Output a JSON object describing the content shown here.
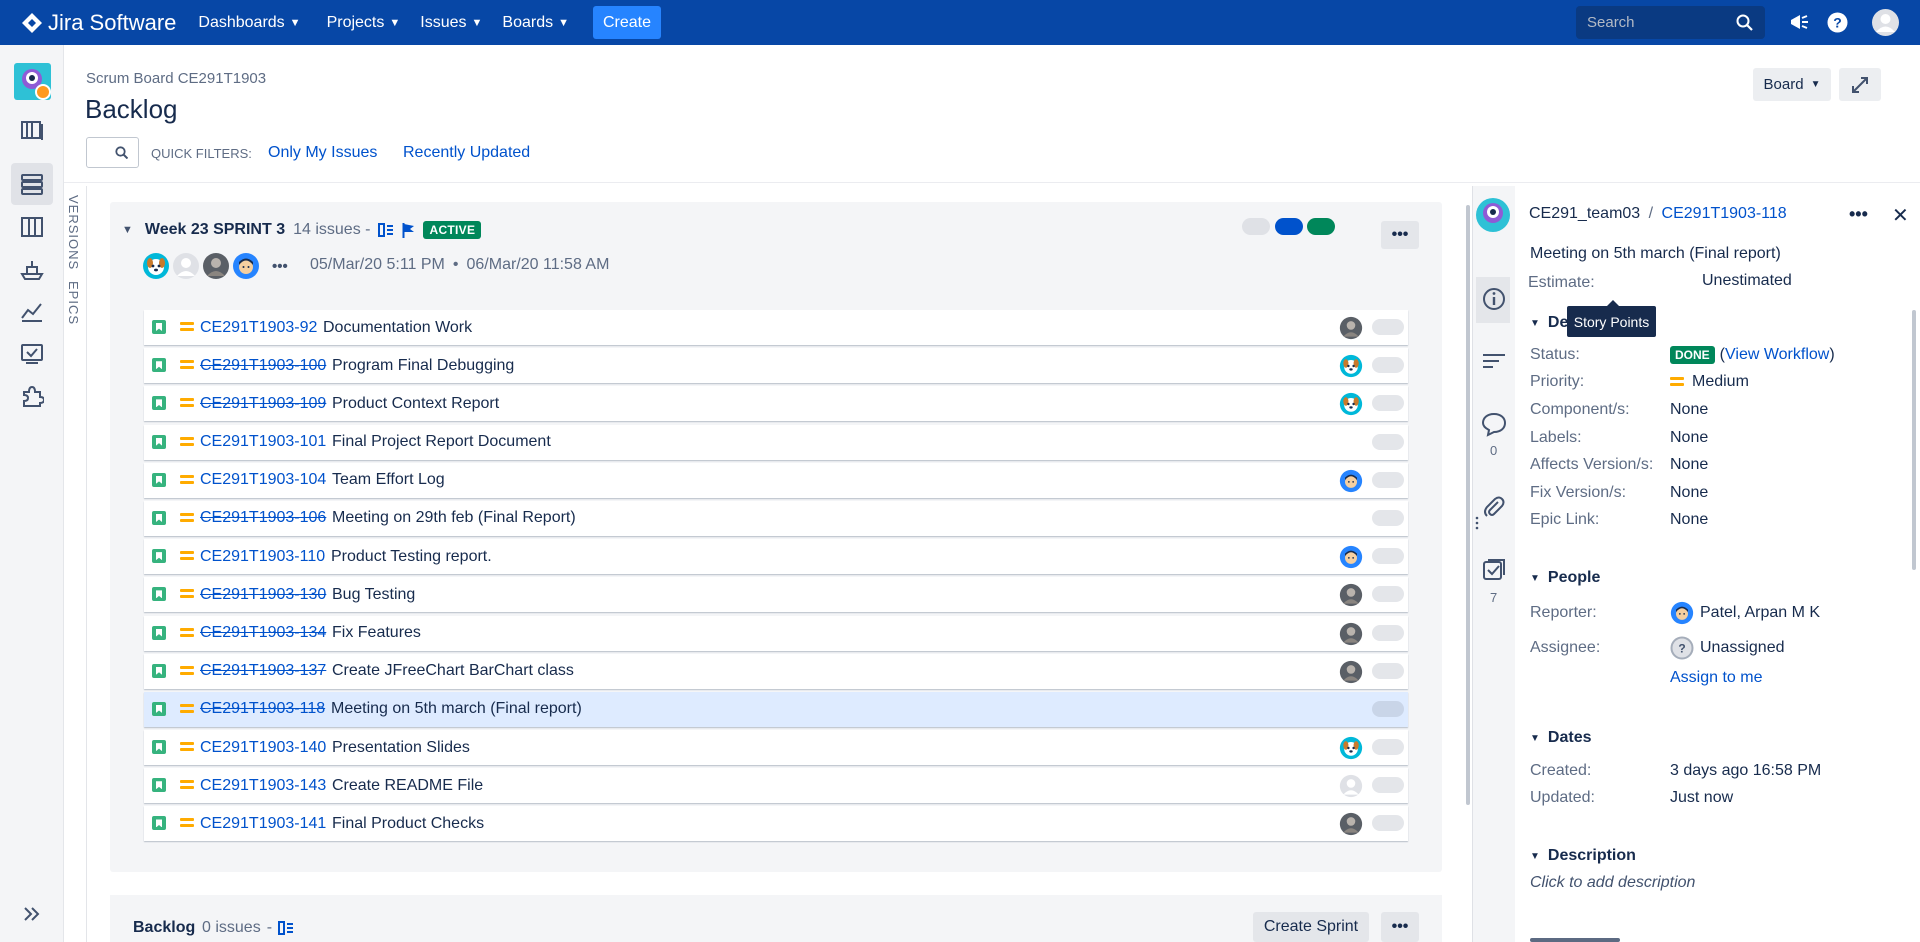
{
  "nav": {
    "logo": "Jira Software",
    "menus": [
      "Dashboards",
      "Projects",
      "Issues",
      "Boards"
    ],
    "create": "Create",
    "search_placeholder": "Search"
  },
  "header": {
    "breadcrumb": "Scrum Board CE291T1903",
    "title": "Backlog",
    "board_button": "Board"
  },
  "quick_filters": {
    "label": "QUICK FILTERS:",
    "items": [
      "Only My Issues",
      "Recently Updated"
    ]
  },
  "side_tabs": {
    "versions": "VERSIONS",
    "epics": "EPICS"
  },
  "sprint": {
    "title": "Week 23 SPRINT 3",
    "count": "14 issues",
    "count_sep": "-",
    "status": "ACTIVE",
    "start": "05/Mar/20 5:11 PM",
    "date_sep": "•",
    "end": "06/Mar/20 11:58 AM",
    "more": "•••",
    "avatars_more": "•••",
    "status_colors": [
      "#dfe1e6",
      "#0052cc",
      "#00875a"
    ]
  },
  "issues": [
    {
      "key": "CE291T1903-92",
      "summary": "Documentation Work",
      "done": false,
      "avatar": "photo"
    },
    {
      "key": "CE291T1903-100",
      "summary": "Program Final Debugging",
      "done": true,
      "avatar": "dog"
    },
    {
      "key": "CE291T1903-109",
      "summary": "Product Context Report",
      "done": true,
      "avatar": "dog"
    },
    {
      "key": "CE291T1903-101",
      "summary": "Final Project Report Document",
      "done": false,
      "avatar": "none"
    },
    {
      "key": "CE291T1903-104",
      "summary": "Team Effort Log",
      "done": false,
      "avatar": "man"
    },
    {
      "key": "CE291T1903-106",
      "summary": "Meeting on 29th feb (Final Report)",
      "done": true,
      "avatar": "none"
    },
    {
      "key": "CE291T1903-110",
      "summary": "Product Testing report.",
      "done": false,
      "avatar": "man"
    },
    {
      "key": "CE291T1903-130",
      "summary": "Bug Testing",
      "done": true,
      "avatar": "photo"
    },
    {
      "key": "CE291T1903-134",
      "summary": "Fix Features",
      "done": true,
      "avatar": "photo"
    },
    {
      "key": "CE291T1903-137",
      "summary": "Create JFreeChart BarChart class",
      "done": true,
      "avatar": "photo"
    },
    {
      "key": "CE291T1903-118",
      "summary": "Meeting on 5th march (Final report)",
      "done": true,
      "avatar": "none",
      "selected": true
    },
    {
      "key": "CE291T1903-140",
      "summary": "Presentation Slides",
      "done": false,
      "avatar": "dog"
    },
    {
      "key": "CE291T1903-143",
      "summary": "Create README File",
      "done": false,
      "avatar": "default"
    },
    {
      "key": "CE291T1903-141",
      "summary": "Final Product Checks",
      "done": false,
      "avatar": "photo"
    }
  ],
  "backlog": {
    "title": "Backlog",
    "count": "0 issues",
    "count_sep": "-",
    "create_sprint": "Create Sprint",
    "more": "•••"
  },
  "detail": {
    "project": "CE291_team03",
    "separator": "/",
    "key": "CE291T1903-118",
    "more": "•••",
    "close": "✕",
    "summary": "Meeting on 5th march (Final report)",
    "estimate_label": "Estimate:",
    "estimate_value": "Unestimated",
    "tooltip": "Story Points",
    "details_title": "De",
    "status_label": "Status:",
    "status_value": "DONE",
    "view_workflow": "View Workflow",
    "priority_label": "Priority:",
    "priority_value": "Medium",
    "fields": [
      {
        "label": "Component/s:",
        "value": "None"
      },
      {
        "label": "Labels:",
        "value": "None"
      },
      {
        "label": "Affects Version/s:",
        "value": "None"
      },
      {
        "label": "Fix Version/s:",
        "value": "None"
      },
      {
        "label": "Epic Link:",
        "value": "None"
      }
    ],
    "people_title": "People",
    "reporter_label": "Reporter:",
    "reporter_value": "Patel, Arpan M K",
    "assignee_label": "Assignee:",
    "assignee_value": "Unassigned",
    "assign_to_me": "Assign to me",
    "dates_title": "Dates",
    "created_label": "Created:",
    "created_value": "3 days ago 16:58 PM",
    "updated_label": "Updated:",
    "updated_value": "Just now",
    "description_title": "Description",
    "description_placeholder": "Click to add description",
    "comments_count": "0",
    "subtasks_count": "7"
  }
}
